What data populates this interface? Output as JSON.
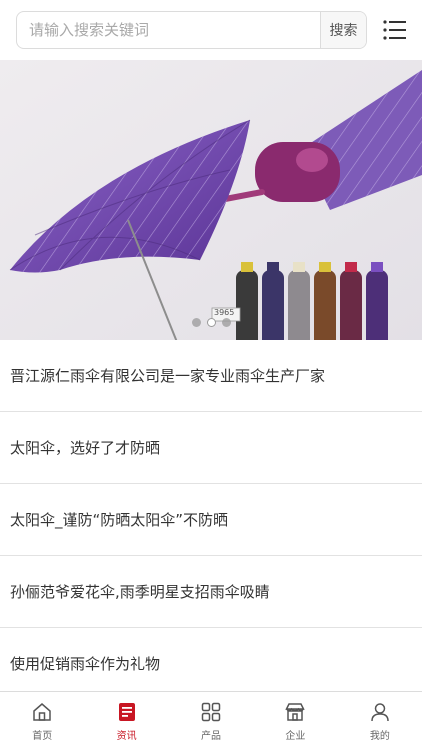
{
  "search": {
    "placeholder": "请输入搜索关键词",
    "button_label": "搜索"
  },
  "banner": {
    "tag_text": "3965"
  },
  "news": [
    {
      "title": "晋江源仁雨伞有限公司是一家专业雨伞生产厂家"
    },
    {
      "title": "太阳伞，选好了才防晒"
    },
    {
      "title": "太阳伞_谨防“防晒太阳伞”不防晒"
    },
    {
      "title": "孙俪范爷爱花伞,雨季明星支招雨伞吸睛"
    },
    {
      "title": "使用促销雨伞作为礼物"
    }
  ],
  "bottom_nav": [
    {
      "label": "首页",
      "icon": "home-icon",
      "active": false
    },
    {
      "label": "资讯",
      "icon": "news-icon",
      "active": true
    },
    {
      "label": "产品",
      "icon": "grid-icon",
      "active": false
    },
    {
      "label": "企业",
      "icon": "store-icon",
      "active": false
    },
    {
      "label": "我的",
      "icon": "user-icon",
      "active": false
    }
  ],
  "colors": {
    "accent": "#c81623",
    "umbrella_purple": "#6a3fa8",
    "banner_bg": "#ebe8ec"
  }
}
